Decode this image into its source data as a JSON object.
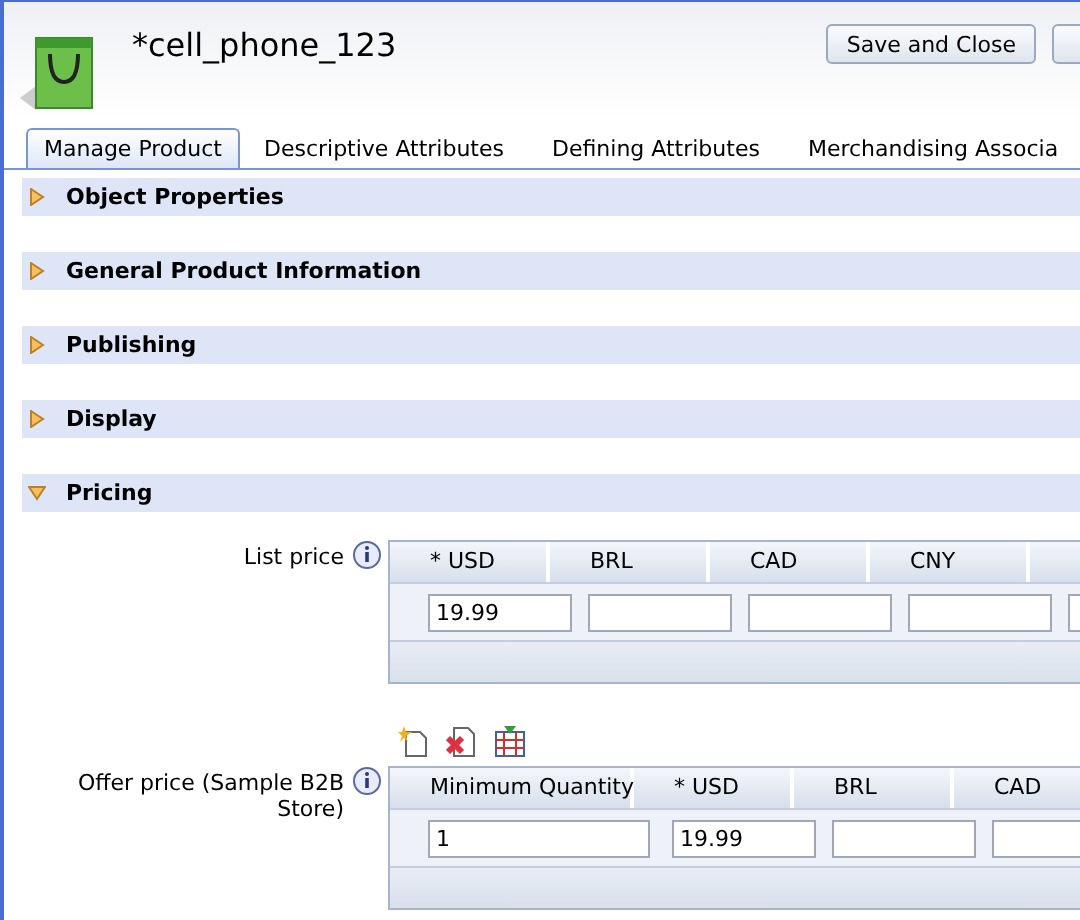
{
  "header": {
    "title": "*cell_phone_123",
    "buttons": [
      "Save and Close"
    ]
  },
  "tabs": [
    {
      "label": "Manage Product",
      "selected": true
    },
    {
      "label": "Descriptive Attributes",
      "selected": false
    },
    {
      "label": "Defining Attributes",
      "selected": false
    },
    {
      "label": "Merchandising Associa",
      "selected": false
    }
  ],
  "sections": [
    {
      "title": "Object Properties",
      "expanded": false
    },
    {
      "title": "General Product Information",
      "expanded": false
    },
    {
      "title": "Publishing",
      "expanded": false
    },
    {
      "title": "Display",
      "expanded": false
    },
    {
      "title": "Pricing",
      "expanded": true
    }
  ],
  "pricing": {
    "list_price": {
      "label": "List price",
      "cells": [
        {
          "column": "* USD",
          "value": "19.99"
        },
        {
          "column": "BRL"
        },
        {
          "column": "CAD"
        },
        {
          "column": "CNY"
        }
      ]
    },
    "offer_price": {
      "label": "Offer price (Sample B2B Store)",
      "cells": [
        {
          "column": "Minimum Quantity",
          "value": "1"
        },
        {
          "column": "* USD",
          "value": "19.99"
        },
        {
          "column": "BRL"
        },
        {
          "column": "CAD"
        }
      ]
    }
  }
}
